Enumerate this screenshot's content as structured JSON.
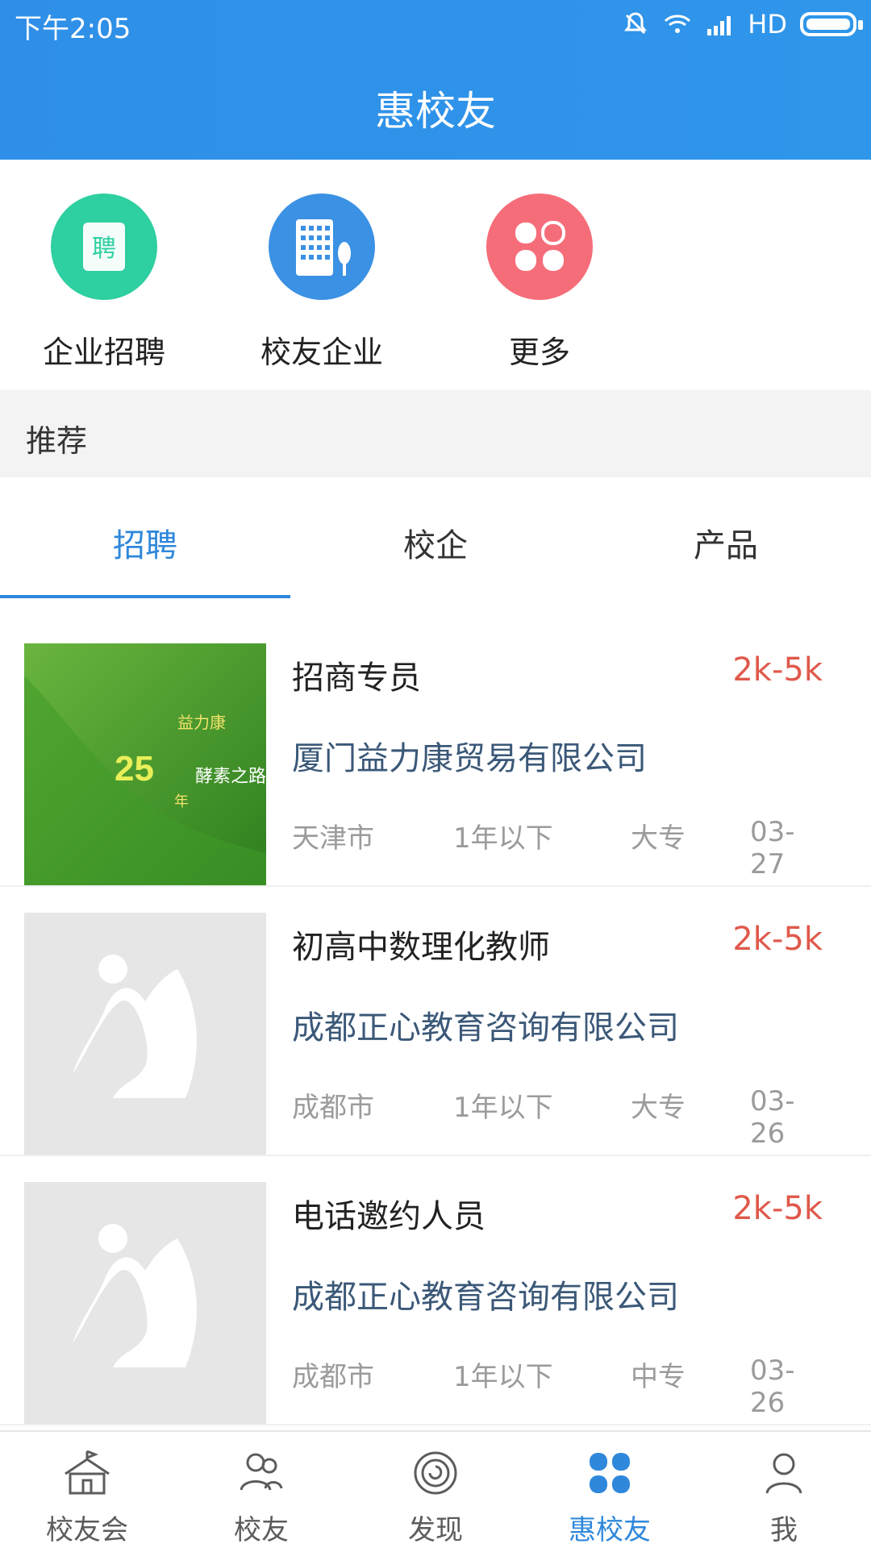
{
  "status_bar": {
    "time": "下午2:05",
    "network": "HD"
  },
  "header": {
    "title": "惠校友"
  },
  "quick_actions": [
    {
      "label": "企业招聘",
      "icon": "recruit-icon"
    },
    {
      "label": "校友企业",
      "icon": "building-icon"
    },
    {
      "label": "更多",
      "icon": "more-icon"
    }
  ],
  "section": {
    "title": "推荐"
  },
  "tabs": [
    {
      "label": "招聘",
      "active": true
    },
    {
      "label": "校企",
      "active": false
    },
    {
      "label": "产品",
      "active": false
    }
  ],
  "jobs": [
    {
      "title": "招商专员",
      "salary": "2k-5k",
      "company": "厦门益力康贸易有限公司",
      "city": "天津市",
      "experience": "1年以下",
      "education": "大专",
      "date": "03-27",
      "thumb_text_1": "益力康",
      "thumb_text_2": "25",
      "thumb_text_3": "年",
      "thumb_text_4": "酵素之路"
    },
    {
      "title": "初高中数理化教师",
      "salary": "2k-5k",
      "company": "成都正心教育咨询有限公司",
      "city": "成都市",
      "experience": "1年以下",
      "education": "大专",
      "date": "03-26"
    },
    {
      "title": "电话邀约人员",
      "salary": "2k-5k",
      "company": "成都正心教育咨询有限公司",
      "city": "成都市",
      "experience": "1年以下",
      "education": "中专",
      "date": "03-26"
    }
  ],
  "bottom_nav": [
    {
      "label": "校友会",
      "icon": "school-icon",
      "active": false
    },
    {
      "label": "校友",
      "icon": "alumni-icon",
      "active": false
    },
    {
      "label": "发现",
      "icon": "discover-icon",
      "active": false
    },
    {
      "label": "惠校友",
      "icon": "clover-icon",
      "active": true
    },
    {
      "label": "我",
      "icon": "profile-icon",
      "active": false
    }
  ],
  "colors": {
    "primary": "#2f88db",
    "salary": "#e0594b",
    "company": "#3b5878"
  }
}
